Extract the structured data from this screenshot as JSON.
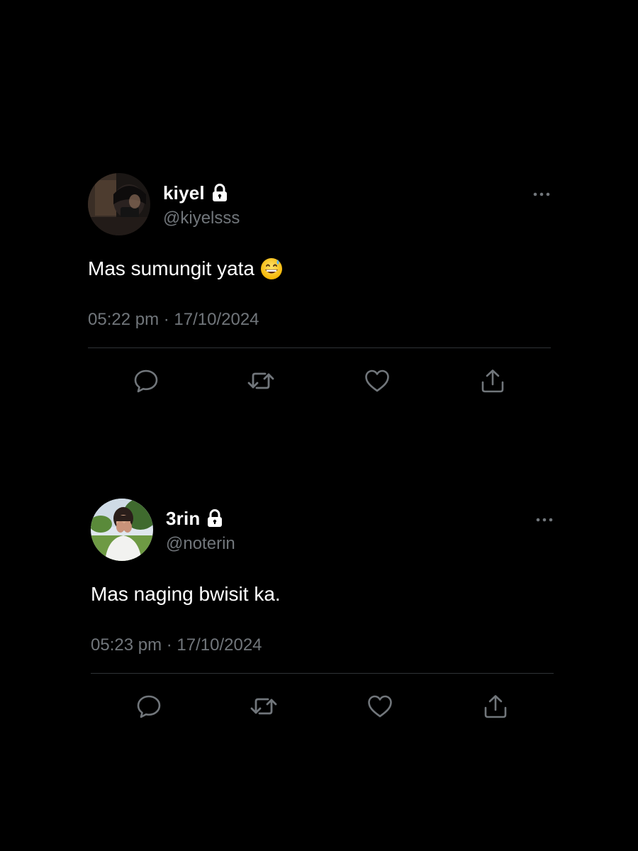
{
  "tweets": [
    {
      "display_name": "kiyel",
      "handle": "@kiyelsss",
      "text": "Mas sumungit yata",
      "emoji": "grinning-sweat-emoji",
      "time": "05:22 pm",
      "date": "17/10/2024",
      "meta_separator": " · ",
      "icons": {
        "lock": "lock-icon",
        "more": "more-options-icon",
        "reply": "reply-icon",
        "retweet": "retweet-icon",
        "like": "heart-icon",
        "share": "share-icon"
      }
    },
    {
      "display_name": "3rin",
      "handle": "@noterin",
      "text": "Mas naging bwisit ka.",
      "time": "05:23 pm",
      "date": "17/10/2024",
      "meta_separator": " · ",
      "icons": {
        "lock": "lock-icon",
        "more": "more-options-icon",
        "reply": "reply-icon",
        "retweet": "retweet-icon",
        "like": "heart-icon",
        "share": "share-icon"
      }
    }
  ],
  "colors": {
    "background": "#000000",
    "primary_text": "#ffffff",
    "secondary_text": "#71767b",
    "divider": "#2f3336"
  }
}
